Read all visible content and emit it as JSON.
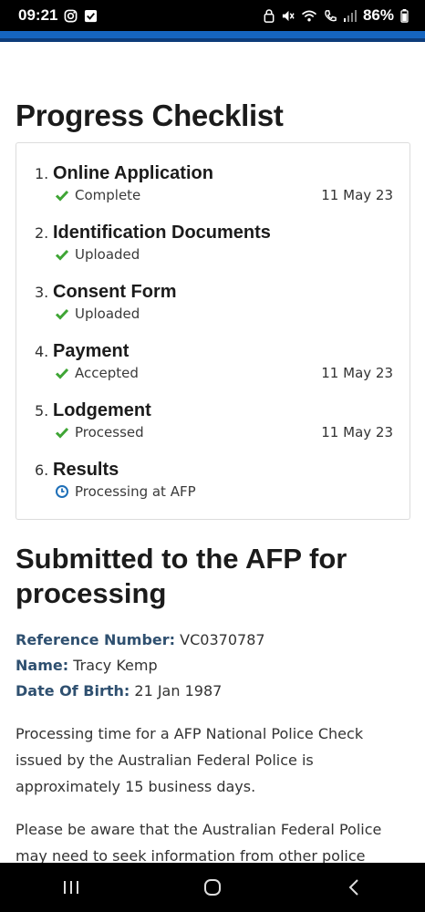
{
  "status_bar": {
    "time": "09:21",
    "battery": "86%"
  },
  "page": {
    "title": "Progress Checklist",
    "steps": [
      {
        "num": "1.",
        "name": "Online Application",
        "status": "Complete",
        "date": "11 May 23",
        "icon": "check-icon"
      },
      {
        "num": "2.",
        "name": "Identification Documents",
        "status": "Uploaded",
        "date": "",
        "icon": "check-icon"
      },
      {
        "num": "3.",
        "name": "Consent Form",
        "status": "Uploaded",
        "date": "",
        "icon": "check-icon"
      },
      {
        "num": "4.",
        "name": "Payment",
        "status": "Accepted",
        "date": "11 May 23",
        "icon": "check-icon"
      },
      {
        "num": "5.",
        "name": "Lodgement",
        "status": "Processed",
        "date": "11 May 23",
        "icon": "check-icon"
      },
      {
        "num": "6.",
        "name": "Results",
        "status": "Processing at AFP",
        "date": "",
        "icon": "clock-icon"
      }
    ],
    "subtitle": "Submitted to the AFP for processing",
    "details": {
      "reference_label": "Reference Number:",
      "reference_value": "VC0370787",
      "name_label": "Name:",
      "name_value": "Tracy Kemp",
      "dob_label": "Date Of Birth:",
      "dob_value": "21 Jan 1987"
    },
    "paragraph1": "Processing time for a AFP National Police Check issued by the Australian Federal Police is approximately 15 business days.",
    "paragraph2": "Please be aware that the Australian Federal Police may need to seek information from other police"
  },
  "colors": {
    "accent": "#1565c0",
    "check": "#3fa535",
    "clock": "#1e6fb8",
    "label": "#2f5070"
  }
}
